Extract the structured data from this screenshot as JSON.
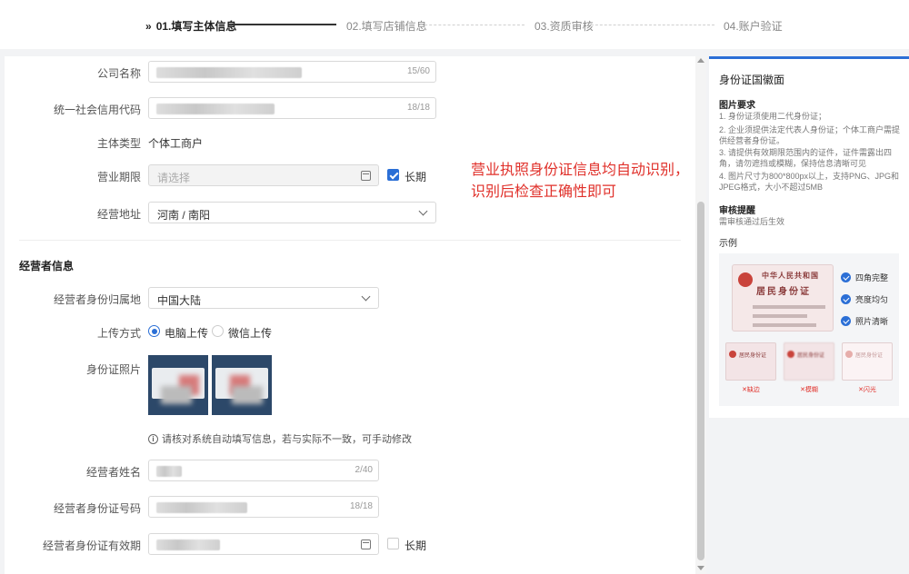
{
  "steps": [
    {
      "label": "01.填写主体信息",
      "active": true
    },
    {
      "label": "02.填写店铺信息",
      "active": false
    },
    {
      "label": "03.资质审核",
      "active": false
    },
    {
      "label": "04.账户验证",
      "active": false
    }
  ],
  "form": {
    "company_name": {
      "label": "公司名称",
      "count": "15/60"
    },
    "credit_code": {
      "label": "统一社会信用代码",
      "count": "18/18"
    },
    "subject_type": {
      "label": "主体类型",
      "value": "个体工商户"
    },
    "business_term": {
      "label": "营业期限",
      "placeholder": "请选择",
      "long_term_label": "长期",
      "long_term_checked": true
    },
    "address": {
      "label": "经营地址",
      "value": "河南 / 南阳"
    }
  },
  "operator": {
    "section_title": "经营者信息",
    "region": {
      "label": "经营者身份归属地",
      "value": "中国大陆"
    },
    "upload": {
      "label": "上传方式",
      "options": [
        "电脑上传",
        "微信上传"
      ],
      "selected": "电脑上传"
    },
    "id_photo": {
      "label": "身份证照片"
    },
    "tip": "请核对系统自动填写信息，若与实际不一致，可手动修改",
    "name": {
      "label": "经营者姓名",
      "count": "2/40"
    },
    "id_number": {
      "label": "经营者身份证号码",
      "count": "18/18"
    },
    "id_validity": {
      "label": "经营者身份证有效期",
      "long_term_label": "长期",
      "long_term_checked": false
    }
  },
  "annotation": {
    "line1": "营业执照身份证信息均自动识别，",
    "line2": "识别后检查正确性即可",
    "color": "#e0302a"
  },
  "side": {
    "title": "身份证国徽面",
    "req_title": "图片要求",
    "requirements": [
      "1. 身份证须使用二代身份证；",
      "2. 企业须提供法定代表人身份证；个体工商户需提供经营者身份证。",
      "3. 请提供有效期限范围内的证件，证件需露出四角，请勿遮挡或模糊，保持信息清晰可见",
      "4. 图片尺寸为800*800px以上，支持PNG、JPG和JPEG格式，大小不超过5MB"
    ],
    "review_title": "审核提醒",
    "review_text": "需审核通过后生效",
    "example_title": "示例",
    "card_title_small": "中华人民共和国",
    "card_title_big": "居民身份证",
    "checks": [
      "四角完整",
      "亮度均匀",
      "照片清晰"
    ],
    "bad_examples": [
      "✕缺边",
      "✕模糊",
      "✕闪光"
    ]
  },
  "colors": {
    "primary": "#2b6fd6",
    "annotation": "#e0302a"
  }
}
